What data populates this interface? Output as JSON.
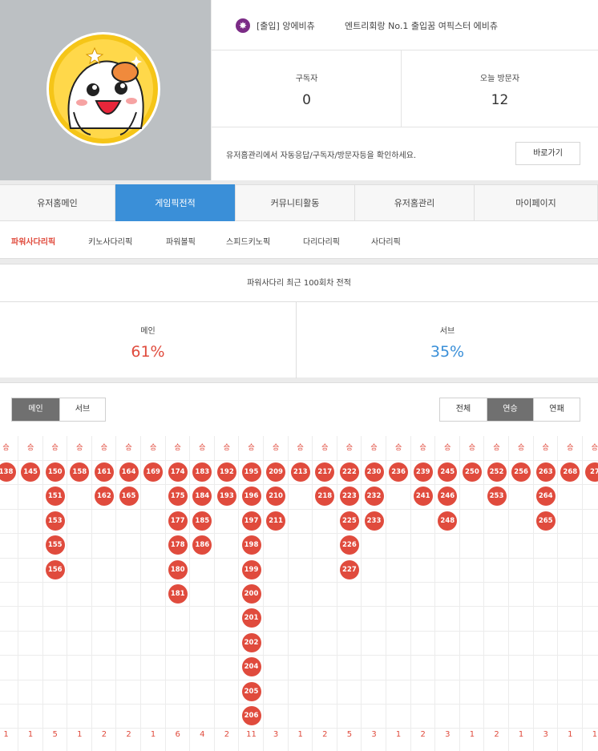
{
  "profile": {
    "badge_icon": "✸",
    "name": "[출입] 앙에비츄",
    "subtitle": "엔트리회랑 No.1 출입꿈 여픽스터 에비츄"
  },
  "stats": [
    {
      "label": "구독자",
      "value": "0"
    },
    {
      "label": "오늘 방문자",
      "value": "12"
    }
  ],
  "notice": {
    "message": "유저홈관리에서 자동응답/구독자/방문자등을 확인하세요.",
    "button": "바로가기"
  },
  "tabs": [
    "유저홈메인",
    "게임픽전적",
    "커뮤니티활동",
    "유저홈관리",
    "마이페이지"
  ],
  "active_tab": 1,
  "subtabs": [
    "파워사다리픽",
    "키노사다리픽",
    "파워볼픽",
    "스피드키노픽",
    "다리다리픽",
    "사다리픽"
  ],
  "active_subtab": 0,
  "summary": {
    "title": "파워사다리 최근 100회차 전적",
    "main_label": "메인",
    "main_pct": "61%",
    "sub_label": "서브",
    "sub_pct": "35%",
    "main_color": "#e04b3d",
    "sub_color": "#3a8fd8"
  },
  "toggle_left": [
    "메인",
    "서브"
  ],
  "toggle_left_active": 0,
  "toggle_right": [
    "전체",
    "연승",
    "연패"
  ],
  "toggle_right_active": 1,
  "streak_header": "승",
  "streaks": [
    {
      "rounds": [
        "138"
      ],
      "count": "1"
    },
    {
      "rounds": [
        "145"
      ],
      "count": "1"
    },
    {
      "rounds": [
        "150",
        "151",
        "153",
        "155",
        "156"
      ],
      "count": "5"
    },
    {
      "rounds": [
        "158"
      ],
      "count": "1"
    },
    {
      "rounds": [
        "161",
        "162"
      ],
      "count": "2"
    },
    {
      "rounds": [
        "164",
        "165"
      ],
      "count": "2"
    },
    {
      "rounds": [
        "169"
      ],
      "count": "1"
    },
    {
      "rounds": [
        "174",
        "175",
        "177",
        "178",
        "180",
        "181"
      ],
      "count": "6"
    },
    {
      "rounds": [
        "183",
        "184",
        "185",
        "186"
      ],
      "count": "4"
    },
    {
      "rounds": [
        "192",
        "193"
      ],
      "count": "2"
    },
    {
      "rounds": [
        "195",
        "196",
        "197",
        "198",
        "199",
        "200",
        "201",
        "202",
        "204",
        "205",
        "206"
      ],
      "count": "11"
    },
    {
      "rounds": [
        "209",
        "210",
        "211"
      ],
      "count": "3"
    },
    {
      "rounds": [
        "213"
      ],
      "count": "1"
    },
    {
      "rounds": [
        "217",
        "218"
      ],
      "count": "2"
    },
    {
      "rounds": [
        "222",
        "223",
        "225",
        "226",
        "227"
      ],
      "count": "5"
    },
    {
      "rounds": [
        "230",
        "232",
        "233"
      ],
      "count": "3"
    },
    {
      "rounds": [
        "236"
      ],
      "count": "1"
    },
    {
      "rounds": [
        "239",
        "241"
      ],
      "count": "2"
    },
    {
      "rounds": [
        "245",
        "246",
        "248"
      ],
      "count": "3"
    },
    {
      "rounds": [
        "250"
      ],
      "count": "1"
    },
    {
      "rounds": [
        "252",
        "253"
      ],
      "count": "2"
    },
    {
      "rounds": [
        "256"
      ],
      "count": "1"
    },
    {
      "rounds": [
        "263",
        "264",
        "265"
      ],
      "count": "3"
    },
    {
      "rounds": [
        "268"
      ],
      "count": "1"
    },
    {
      "rounds": [
        "27"
      ],
      "count": "1"
    }
  ]
}
